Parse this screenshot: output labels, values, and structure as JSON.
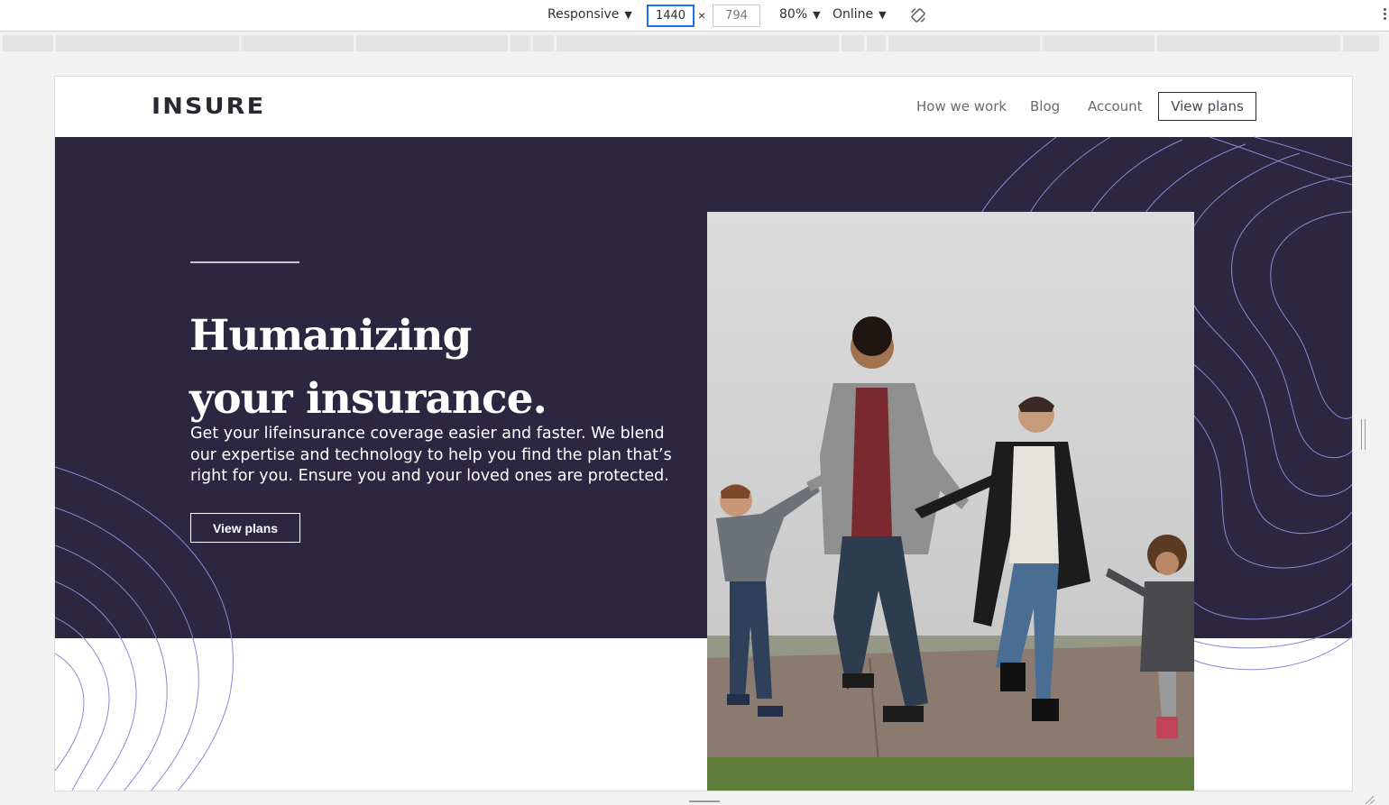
{
  "devtools": {
    "device": "Responsive",
    "width": "1440",
    "height": "794",
    "times": "×",
    "zoom": "80%",
    "network": "Online",
    "rotate_icon": "rotate-icon",
    "more_icon": "more-vert-icon"
  },
  "header": {
    "logo": "INSURE",
    "nav": [
      "How we work",
      "Blog",
      "Account"
    ],
    "cta": "View plans"
  },
  "hero": {
    "title_line1": "Humanizing",
    "title_line2": "your insurance.",
    "body": "Get your lifeinsurance coverage easier and faster. We blend our expertise and technology to help you find the plan that’s right for you. Ensure you and your loved ones are protected.",
    "cta": "View plans",
    "image_alt": "family-photo"
  },
  "colors": {
    "hero_bg": "#2c2640",
    "pattern_stroke": "#7f7fd0",
    "text_dark": "#2c2830"
  }
}
